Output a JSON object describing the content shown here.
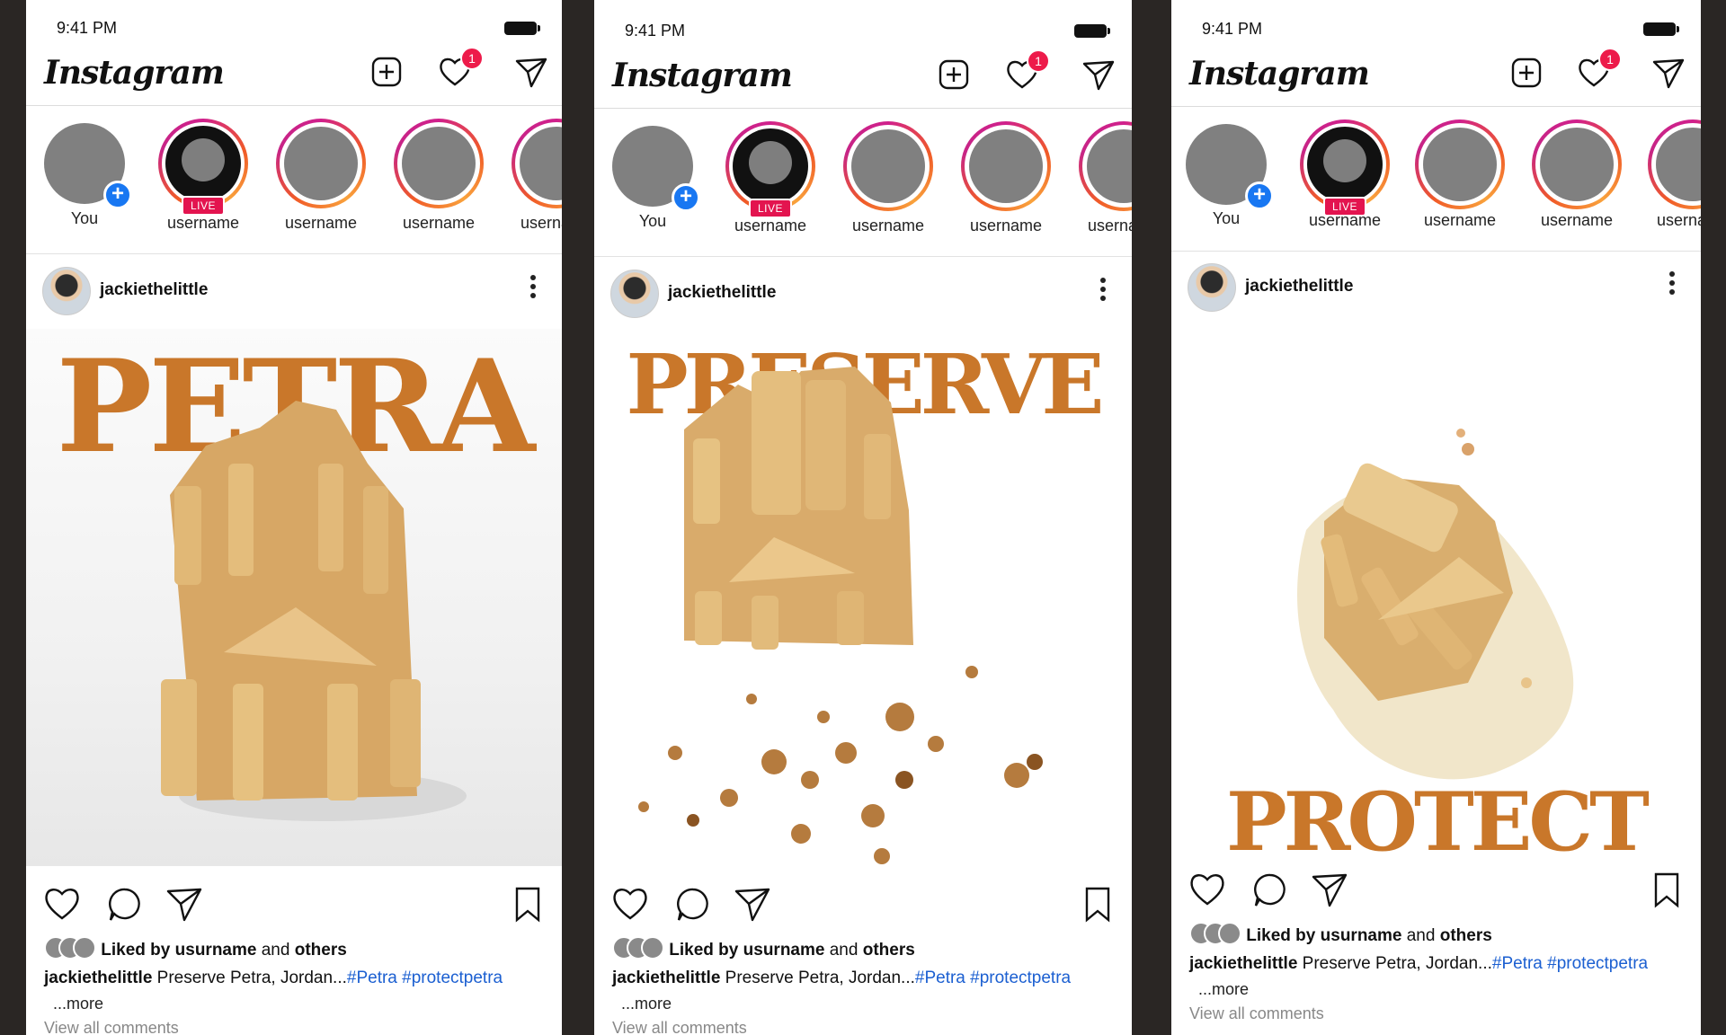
{
  "status": {
    "time": "9:41 PM"
  },
  "app": {
    "logo": "Instagram",
    "notification_count": "1"
  },
  "stories": [
    {
      "label": "You",
      "type": "you"
    },
    {
      "label": "username",
      "type": "live",
      "live_label": "LIVE"
    },
    {
      "label": "username",
      "type": "ring"
    },
    {
      "label": "username",
      "type": "ring"
    },
    {
      "label": "username",
      "type": "ring"
    }
  ],
  "post": {
    "username": "jackiethelittle",
    "liked_prefix": "Liked by",
    "liked_user": "usurname",
    "liked_mid": "and",
    "liked_suffix": "others",
    "caption_user": "jackiethelittle",
    "caption_text": "Preserve Petra, Jordan...",
    "hashtags": "#Petra #protectpetra",
    "more": "...more",
    "view_comments": "View all comments"
  },
  "panels": [
    {
      "headline": "PETRA"
    },
    {
      "headline": "PRESERVE"
    },
    {
      "headline": "PROTECT"
    }
  ],
  "colors": {
    "accent": "#c9772a",
    "hashtag": "#1b5fd1",
    "live": "#e3144f",
    "plus": "#1877f2"
  }
}
